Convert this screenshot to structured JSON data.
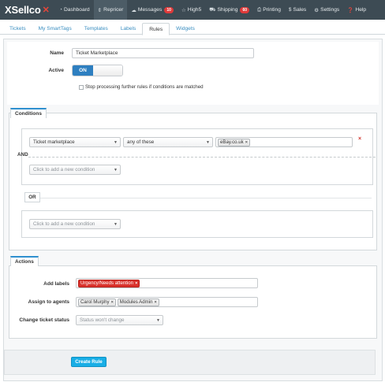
{
  "app": {
    "brand": "XSellco"
  },
  "nav": [
    {
      "label": "Dashboard",
      "icon": "dashboard-icon"
    },
    {
      "label": "Repricer",
      "icon": "sort-icon"
    },
    {
      "label": "Messages",
      "icon": "chat-icon",
      "badge": "10"
    },
    {
      "label": "High5",
      "icon": "star-icon"
    },
    {
      "label": "Shipping",
      "icon": "truck-icon",
      "badge": "60"
    },
    {
      "label": "Printing",
      "icon": "printer-icon"
    },
    {
      "label": "Sales",
      "icon": "dollar-icon"
    },
    {
      "label": "Settings",
      "icon": "gear-icon"
    },
    {
      "label": "Help",
      "icon": "help-icon"
    }
  ],
  "tabs": [
    "Tickets",
    "My SmartTags",
    "Templates",
    "Labels",
    "Rules",
    "Widgets"
  ],
  "active_tab": "Rules",
  "form": {
    "name_label": "Name",
    "name_value": "Ticket Marketplace",
    "active_label": "Active",
    "active_toggle": "ON",
    "stop_processing_label": "Stop processing further rules if conditions are matched"
  },
  "conditions": {
    "header": "Conditions",
    "field": "Ticket marketplace",
    "operator": "any of these",
    "value_tag": "eBay.co.uk",
    "and_label": "AND",
    "add_placeholder": "Click to add a new condition",
    "or_label": "OR",
    "add_placeholder_2": "Click to add a new condition"
  },
  "actions": {
    "header": "Actions",
    "add_labels_label": "Add labels",
    "label_tag": "Urgency/Needs attention",
    "assign_label": "Assign to agents",
    "agents": [
      "Carol Murphy",
      "Modules Admin"
    ],
    "status_label": "Change ticket status",
    "status_placeholder": "Status won't change"
  },
  "create_button": "Create Rule",
  "colors": {
    "topbar": "#3d4b54",
    "accent": "#2e7fc0",
    "button": "#19aee6",
    "tag_red": "#d9322c",
    "badge": "#e03a3a"
  }
}
